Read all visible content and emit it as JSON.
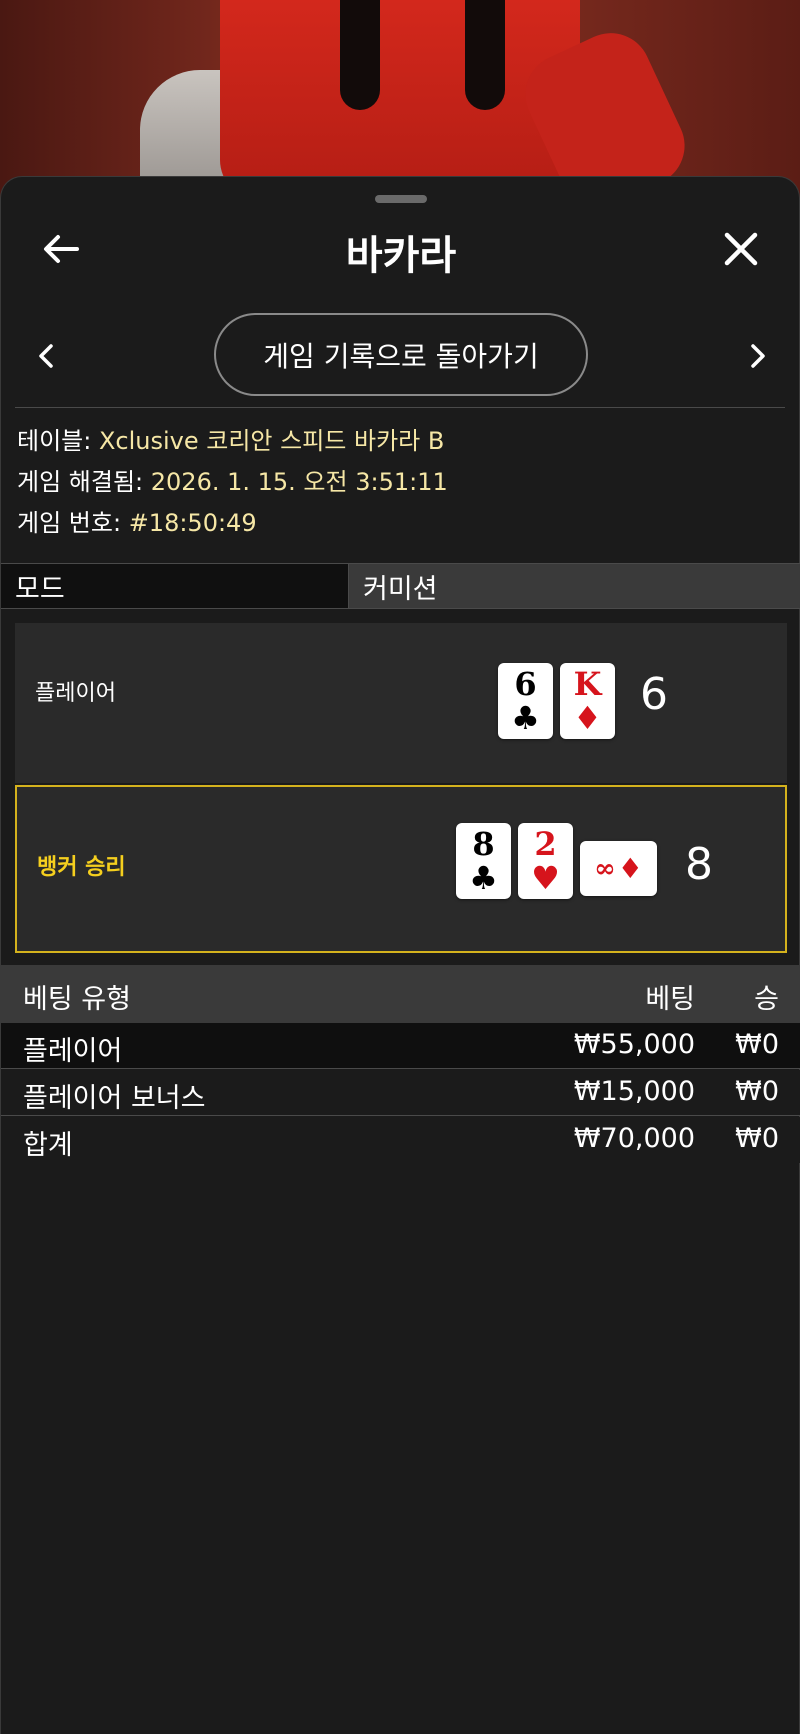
{
  "header": {
    "title": "바카라"
  },
  "nav": {
    "history_button": "게임 기록으로 돌아가기"
  },
  "info": {
    "table_label": "테이블:",
    "table_value": "Xclusive 코리안 스피드 바카라 B",
    "resolved_label": "게임 해결됨:",
    "resolved_value": "2026. 1. 15. 오전 3:51:11",
    "game_no_label": "게임 번호:",
    "game_no_value": "#18:50:49"
  },
  "tabs": {
    "mode": "모드",
    "commission": "커미션"
  },
  "hands": {
    "player": {
      "label": "플레이어",
      "score": "6",
      "cards": [
        {
          "rank": "6",
          "suit": "♣",
          "color": "black"
        },
        {
          "rank": "K",
          "suit": "♦",
          "color": "red"
        }
      ]
    },
    "banker": {
      "label": "뱅커 승리",
      "score": "8",
      "cards": [
        {
          "rank": "8",
          "suit": "♣",
          "color": "black"
        },
        {
          "rank": "2",
          "suit": "♥",
          "color": "red"
        },
        {
          "rank": "∞",
          "suit": "♦",
          "color": "red",
          "sideways": true
        }
      ]
    }
  },
  "bets": {
    "headers": {
      "type": "베팅 유형",
      "bet": "베팅",
      "win": "승"
    },
    "rows": [
      {
        "type": "플레이어",
        "bet": "₩55,000",
        "win": "₩0"
      },
      {
        "type": "플레이어 보너스",
        "bet": "₩15,000",
        "win": "₩0"
      }
    ],
    "total": {
      "type": "합계",
      "bet": "₩70,000",
      "win": "₩0"
    }
  },
  "colors": {
    "accent_gold": "#d4b21d",
    "winner_text": "#f5cf1e",
    "info_value": "#f6e7a6"
  }
}
